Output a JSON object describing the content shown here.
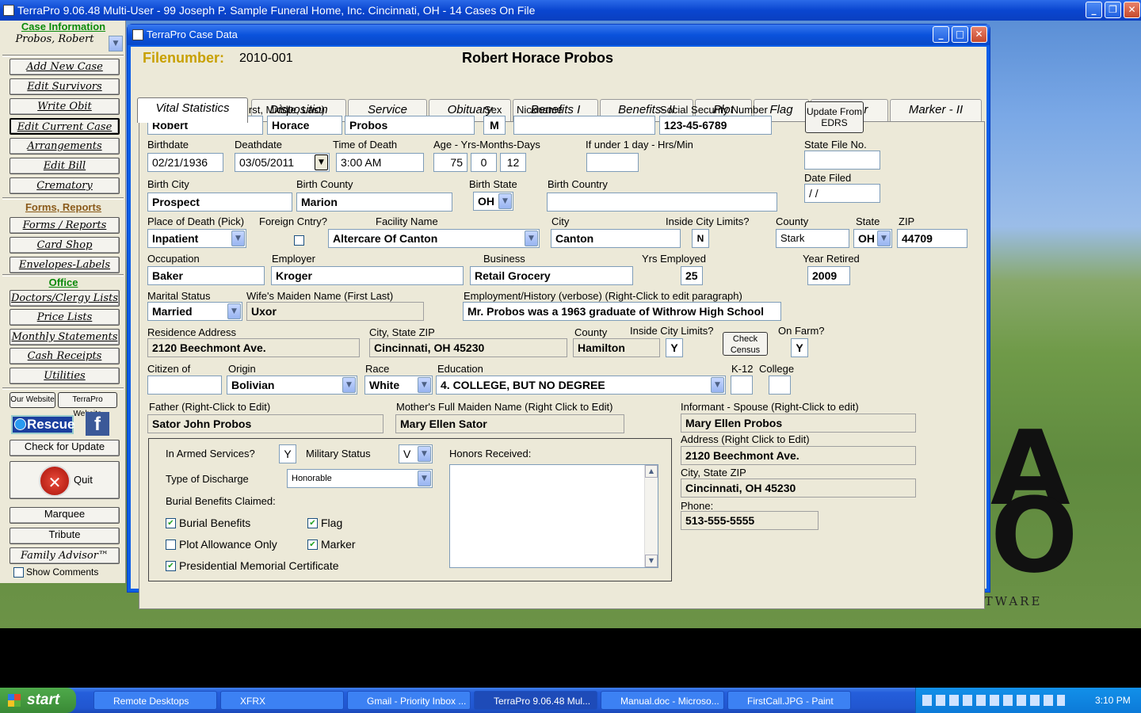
{
  "app": {
    "title": "TerraPro 9.06.48 Multi-User - 99 Joseph P. Sample Funeral Home, Inc. Cincinnati, OH -      14 Cases On File"
  },
  "desktop": {
    "tagline": "PROFESSIONAL FUNERAL HOME SOFTWARE",
    "logo_a": "A",
    "logo_o": "O"
  },
  "sidebar": {
    "case_info_head": "Case Information",
    "case_name": "Probos, Robert",
    "forms_head": "Forms, Reports",
    "office_head": "Office",
    "buttons1": [
      "Add New Case",
      "Edit Survivors",
      "Write Obit",
      "Edit Current Case",
      "Arrangements",
      "Edit Bill",
      "Crematory"
    ],
    "buttons2": [
      "Forms / Reports",
      "Card Shop",
      "Envelopes-Labels"
    ],
    "buttons3": [
      "Doctors/Clergy Lists",
      "Price Lists",
      "Monthly Statements",
      "Cash Receipts",
      "Utilities"
    ],
    "our_website": "Our Website",
    "terrapro_website": "TerraPro Website",
    "rescue": "Rescue",
    "facebook": "f",
    "check_update": "Check for Update",
    "quit": "Quit",
    "marquee": "Marquee",
    "tribute": "Tribute",
    "family_advisor": "Family Advisor™",
    "show_comments": "Show Comments"
  },
  "case": {
    "window_title": "TerraPro Case Data",
    "filenumber_label": "Filenumber:",
    "filenumber": "2010-001",
    "full_name": "Robert Horace Probos",
    "tabs": [
      "Vital Statistics",
      "Disposition",
      "Service",
      "Obituary",
      "Benefits I",
      "Benefits- II",
      "Plot",
      "Flag",
      "Marker",
      "Marker - II"
    ]
  },
  "form": {
    "labels": {
      "name": "Name of deceased (First, Middle, Last)",
      "sex": "Sex",
      "nickname": "Nickname",
      "ssn": "Social Security Number",
      "birthdate": "Birthdate",
      "deathdate": "Deathdate",
      "time_of_death": "Time of Death",
      "age": "Age - Yrs-Months-Days",
      "under1day": "If under 1 day - Hrs/Min",
      "state_file": "State File No.",
      "date_filed": "Date Filed",
      "birth_city": "Birth City",
      "birth_county": "Birth County",
      "birth_state": "Birth State",
      "birth_country": "Birth Country",
      "place_of_death": "Place of Death (Pick)",
      "foreign": "Foreign Cntry?",
      "facility": "Facility Name",
      "city": "City",
      "inside_limits": "Inside City Limits?",
      "county": "County",
      "state": "State",
      "zip": "ZIP",
      "occupation": "Occupation",
      "employer": "Employer",
      "business": "Business",
      "yrs_employed": "Yrs Employed",
      "year_retired": "Year Retired",
      "marital": "Marital Status",
      "wife_maiden": "Wife's Maiden Name (First Last)",
      "employment_history": "Employment/History (verbose) (Right-Click to edit paragraph)",
      "residence": "Residence Address",
      "res_city": "City, State ZIP",
      "res_county": "County",
      "res_inside": "Inside City Limits?",
      "on_farm": "On Farm?",
      "citizen": "Citizen of",
      "origin": "Origin",
      "race": "Race",
      "education": "Education",
      "k12": "K-12",
      "college": "College",
      "father": "Father (Right-Click to Edit)",
      "mother": "Mother's Full Maiden Name (Right Click to Edit)",
      "informant": "Informant - Spouse (Right-Click to edit)",
      "inf_address": "Address  (Right Click to Edit)",
      "inf_city": "City, State ZIP",
      "inf_phone": "Phone:",
      "armed": "In Armed Services?",
      "military": "Military Status",
      "discharge": "Type of Discharge",
      "burial_claimed": "Burial Benefits Claimed:",
      "honors": "Honors Received:"
    },
    "values": {
      "first": "Robert",
      "middle": "Horace",
      "last": "Probos",
      "sex": "M",
      "nickname": "",
      "ssn": "123-45-6789",
      "update_edrs": "Update From EDRS",
      "birthdate": "02/21/1936",
      "deathdate": "03/05/2011",
      "time_of_death": "3:00 AM",
      "age_y": "75",
      "age_m": "0",
      "age_d": "12",
      "under1day": "",
      "state_file": "",
      "date_filed": " /  /",
      "birth_city": "Prospect",
      "birth_county": "Marion",
      "birth_state": "OH",
      "birth_country": "",
      "place_of_death": "Inpatient",
      "facility": "Altercare Of Canton",
      "city": "Canton",
      "inside_limits": "N",
      "county": "Stark",
      "state": "OH",
      "zip": "44709",
      "occupation": "Baker",
      "employer": "Kroger",
      "business": "Retail Grocery",
      "yrs_employed": "25",
      "year_retired": "2009",
      "marital": "Married",
      "wife_maiden": "Uxor",
      "employment_history": "Mr. Probos was a 1963 graduate of Withrow High School",
      "residence": "2120 Beechmont Ave.",
      "res_city": "Cincinnati, OH 45230",
      "res_county": "Hamilton",
      "res_inside": "Y",
      "check_census": "Check Census",
      "on_farm": "Y",
      "citizen": "",
      "origin": "Bolivian",
      "race": "White",
      "education": "4. COLLEGE, BUT NO DEGREE",
      "k12": "",
      "college": "",
      "father": "Sator John Probos",
      "mother": "Mary Ellen Sator",
      "informant": "Mary Ellen Probos",
      "inf_address": "2120 Beechmont Ave.",
      "inf_city": "Cincinnati, OH 45230",
      "inf_phone": "513-555-5555",
      "armed": "Y",
      "military": "V",
      "discharge": "Honorable",
      "honors": ""
    },
    "checks": {
      "burial_benefits": "Burial Benefits",
      "plot_allowance": "Plot Allowance Only",
      "presidential": "Presidential Memorial Certificate",
      "flag": "Flag",
      "marker": "Marker"
    }
  },
  "taskbar": {
    "start": "start",
    "tasks": [
      "Remote Desktops",
      "XFRX",
      "Gmail - Priority Inbox ...",
      "TerraPro 9.06.48 Mul...",
      "Manual.doc - Microso...",
      "FirstCall.JPG - Paint"
    ],
    "clock": "3:10 PM"
  },
  "colors": {
    "xp_blue": "#0a52dc",
    "form_bg": "#ece9d8",
    "filenumber_label": "#c8a000",
    "sidebar_head_green": "#0a8a0a",
    "sidebar_head_brown": "#8a5a1a"
  }
}
